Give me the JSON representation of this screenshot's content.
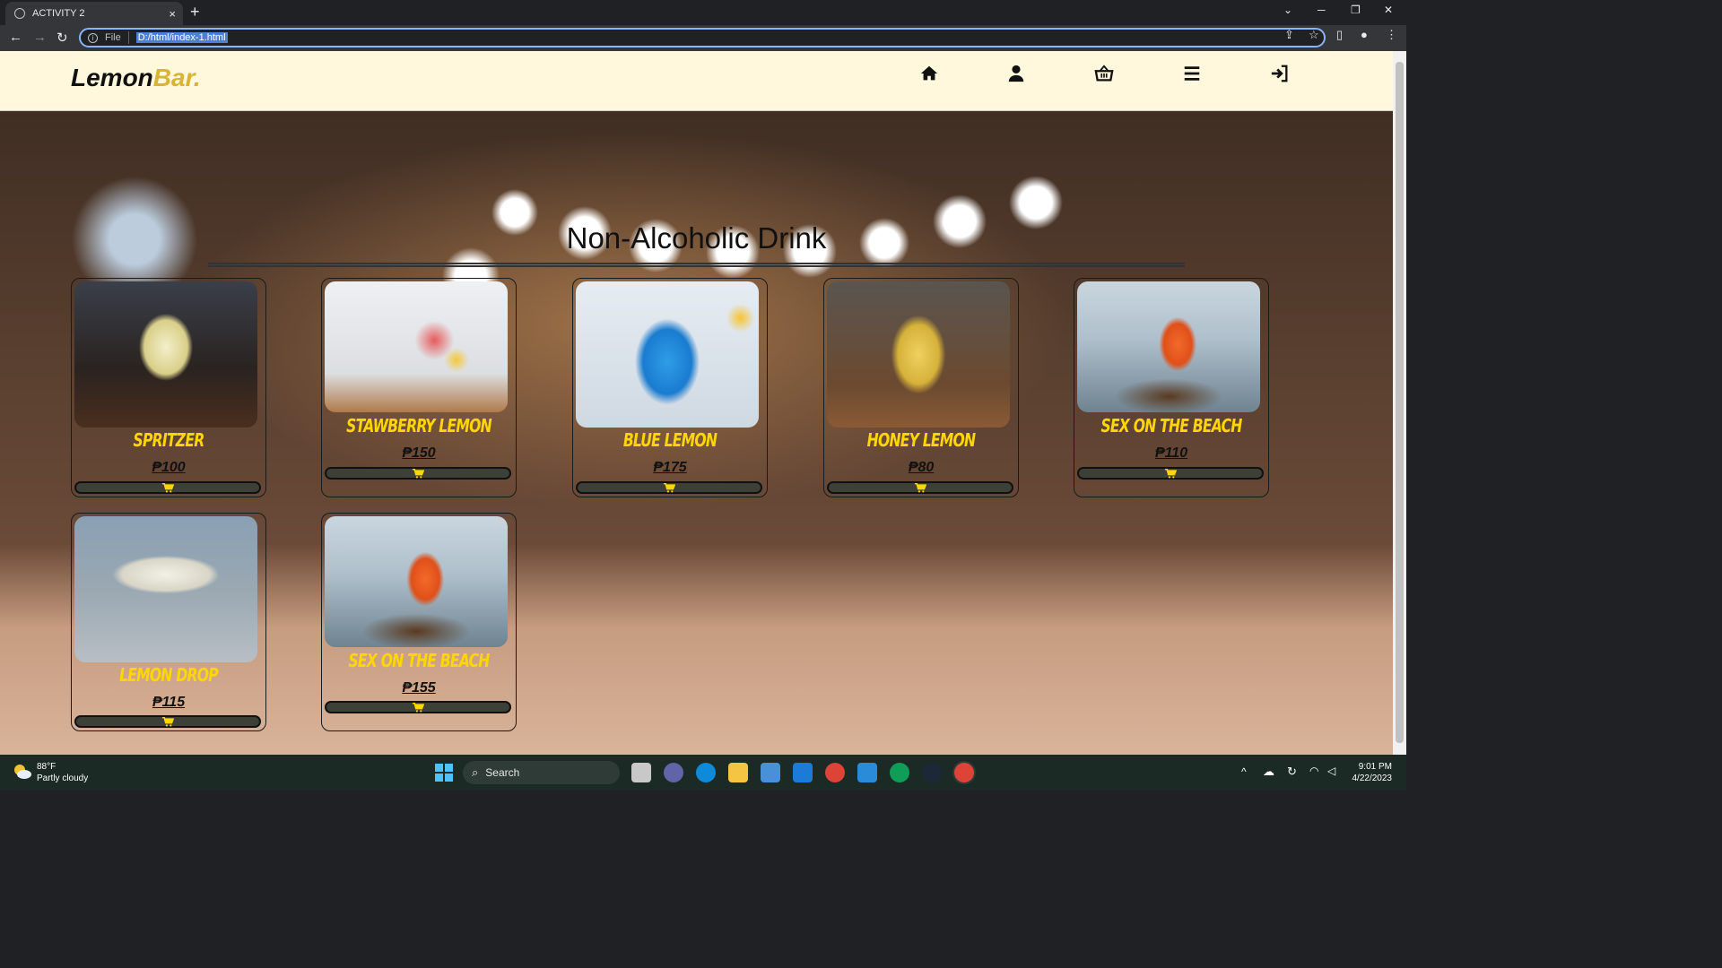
{
  "browser": {
    "tab_title": "ACTIVITY 2",
    "tab_close": "×",
    "new_tab": "+",
    "protocol_label": "File",
    "url": "D:/html/index-1.html"
  },
  "header": {
    "logo_part1": "Lemon",
    "logo_part2": "Bar.",
    "nav_icons": [
      "home-icon",
      "user-icon",
      "basket-icon",
      "menu-icon",
      "sign-in-icon"
    ]
  },
  "main": {
    "section_title": "Non-Alcoholic Drink",
    "products": [
      {
        "name": "SPRITZER",
        "price": "₱100",
        "image": "spritzer-glass"
      },
      {
        "name": "STAWBERRY LEMON",
        "price": "₱150",
        "image": "strawberry-lemonade"
      },
      {
        "name": "BLUE LEMON",
        "price": "₱175",
        "image": "blue-lemon-drink"
      },
      {
        "name": "HONEY LEMON",
        "price": "₱80",
        "image": "honey-lemon-jar"
      },
      {
        "name": "SEX ON THE BEACH",
        "price": "₱110",
        "image": "beach-cocktail"
      },
      {
        "name": "LEMON DROP",
        "price": "₱115",
        "image": "lemon-drop-glass"
      },
      {
        "name": "SEX ON THE BEACH",
        "price": "₱155",
        "image": "beach-cocktail"
      }
    ]
  },
  "taskbar": {
    "weather_temp": "88°F",
    "weather_desc": "Partly cloudy",
    "search_label": "Search",
    "time": "9:01 PM",
    "date": "4/22/2023"
  },
  "colors": {
    "header_bg": "#fff8dc",
    "logo_accent": "#d8b432",
    "product_name": "#ffd600",
    "cart_button": "#3d4036"
  }
}
